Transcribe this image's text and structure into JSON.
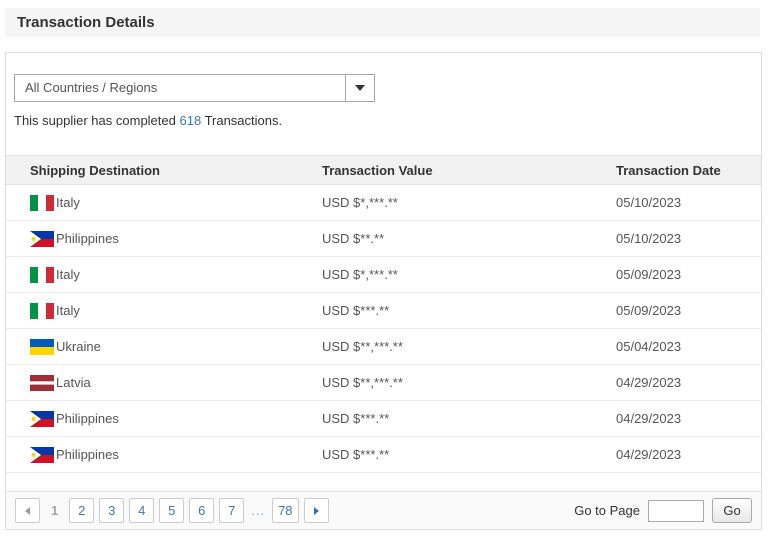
{
  "page": {
    "title": "Transaction Details"
  },
  "filter": {
    "dropdown_value": "All Countries / Regions"
  },
  "summary": {
    "prefix": "This supplier has completed ",
    "count": "618",
    "suffix": " Transactions."
  },
  "table": {
    "columns": [
      "Shipping Destination",
      "Transaction Value",
      "Transaction Date"
    ],
    "rows": [
      {
        "flag": "italy",
        "destination": "Italy",
        "value": "USD $*,***.**",
        "date": "05/10/2023"
      },
      {
        "flag": "philippines",
        "destination": "Philippines",
        "value": "USD $**.**",
        "date": "05/10/2023"
      },
      {
        "flag": "italy",
        "destination": "Italy",
        "value": "USD $*,***.**",
        "date": "05/09/2023"
      },
      {
        "flag": "italy",
        "destination": "Italy",
        "value": "USD $***.**",
        "date": "05/09/2023"
      },
      {
        "flag": "ukraine",
        "destination": "Ukraine",
        "value": "USD $**,***.**",
        "date": "05/04/2023"
      },
      {
        "flag": "latvia",
        "destination": "Latvia",
        "value": "USD $**,***.**",
        "date": "04/29/2023"
      },
      {
        "flag": "philippines",
        "destination": "Philippines",
        "value": "USD $***.**",
        "date": "04/29/2023"
      },
      {
        "flag": "philippines",
        "destination": "Philippines",
        "value": "USD $***.**",
        "date": "04/29/2023"
      }
    ]
  },
  "flags": {
    "italy": {
      "type": "vertical",
      "colors": [
        "#009246",
        "#ffffff",
        "#ce2b37"
      ]
    },
    "philippines": {
      "type": "philippines",
      "blue": "#0038a8",
      "red": "#ce1126",
      "white": "#ffffff",
      "sun": "#fcd116"
    },
    "ukraine": {
      "type": "horizontal",
      "colors": [
        "#005bbb",
        "#ffd500"
      ]
    },
    "latvia": {
      "type": "horizontal",
      "colors": [
        "#9e3039",
        "#ffffff",
        "#9e3039"
      ],
      "weights": [
        2,
        1,
        2
      ]
    }
  },
  "pagination": {
    "current_page": "1",
    "pages": [
      "2",
      "3",
      "4",
      "5",
      "6",
      "7"
    ],
    "ellipsis": "...",
    "last_page": "78",
    "goto_label": "Go to Page",
    "goto_value": "",
    "go_button": "Go"
  },
  "colors": {
    "link_blue": "#3a77bd",
    "page_number_blue": "#4175b8",
    "title_band_bg": "#f5f5f5",
    "table_header_bg": "#f2f2f2",
    "footer_bg": "#fafafa",
    "border_gray": "#dddddd"
  }
}
